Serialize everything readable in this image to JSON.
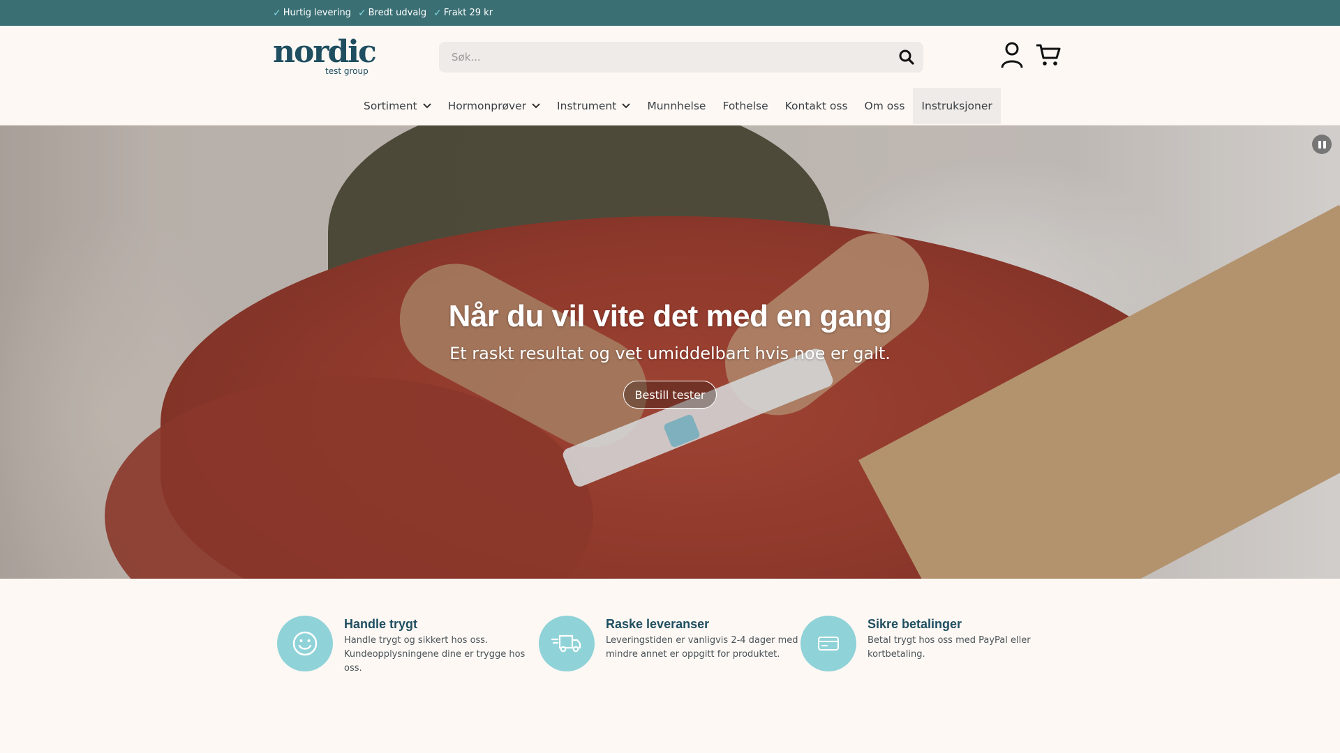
{
  "topbar": {
    "usps": [
      {
        "icon": "check-icon",
        "label": "Hurtig levering"
      },
      {
        "icon": "check-icon",
        "label": "Bredt udvalg"
      },
      {
        "icon": "check-icon",
        "label": "Frakt 29 kr"
      }
    ]
  },
  "header": {
    "logo": {
      "word": "nordic",
      "sub": "test group"
    },
    "search": {
      "placeholder": "Søk...",
      "value": "",
      "icon": "search-icon"
    },
    "account_icon": "user-icon",
    "cart_icon": "cart-icon"
  },
  "nav": {
    "items": [
      {
        "label": "Sortiment",
        "has_dropdown": true
      },
      {
        "label": "Hormonprøver",
        "has_dropdown": true
      },
      {
        "label": "Instrument",
        "has_dropdown": true
      },
      {
        "label": "Munnhelse",
        "has_dropdown": false
      },
      {
        "label": "Fothelse",
        "has_dropdown": false
      },
      {
        "label": "Kontakt oss",
        "has_dropdown": false
      },
      {
        "label": "Om oss",
        "has_dropdown": false
      },
      {
        "label": "Instruksjoner",
        "has_dropdown": false,
        "active": true
      }
    ]
  },
  "hero": {
    "title": "Når du vil vite det med en gang",
    "subtitle": "Et raskt resultat og vet umiddelbart hvis noe er galt.",
    "cta_label": "Bestill tester",
    "pause_icon": "pause-icon"
  },
  "features": [
    {
      "icon": "smiley-icon",
      "title": "Handle trygt",
      "text": "Handle trygt og sikkert hos oss. Kundeopplysningene dine er trygge hos oss."
    },
    {
      "icon": "truck-icon",
      "title": "Raske leveranser",
      "text": "Leveringstiden er vanligvis 2-4 dager med mindre annet er oppgitt for produktet."
    },
    {
      "icon": "credit-card-icon",
      "title": "Sikre betalinger",
      "text": "Betal trygt hos oss med PayPal eller kortbetaling."
    }
  ],
  "colors": {
    "topbar": "#3a6f74",
    "brand": "#1f4e60",
    "accent": "#8fd2d8",
    "background": "#fdf8f4"
  }
}
